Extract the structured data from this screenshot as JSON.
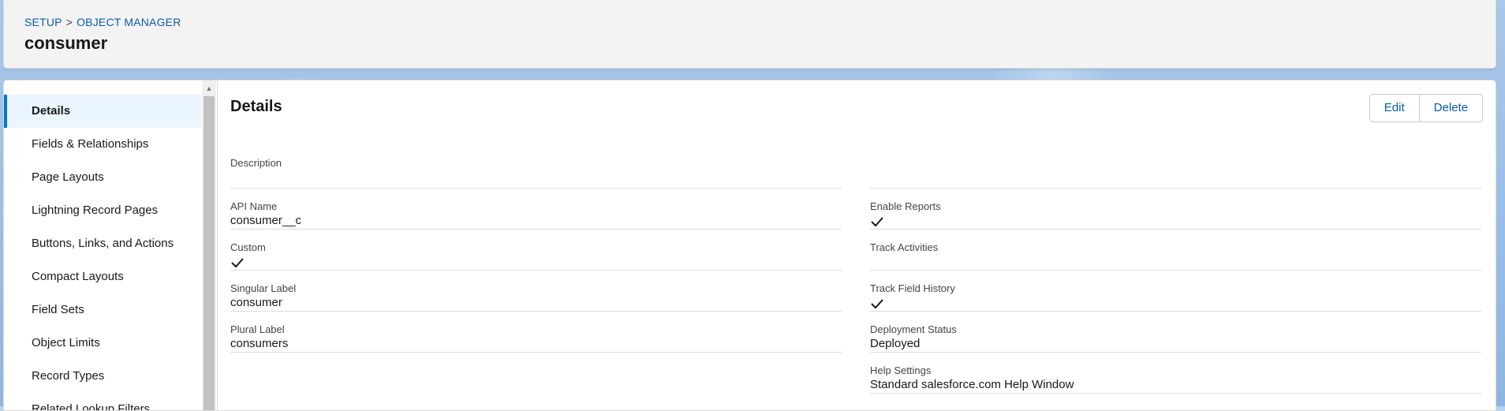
{
  "header": {
    "breadcrumb": [
      "SETUP",
      "OBJECT MANAGER"
    ],
    "breadcrumb_separator": ">",
    "title": "consumer"
  },
  "sidebar": {
    "items": [
      {
        "label": "Details",
        "active": true
      },
      {
        "label": "Fields & Relationships"
      },
      {
        "label": "Page Layouts"
      },
      {
        "label": "Lightning Record Pages"
      },
      {
        "label": "Buttons, Links, and Actions"
      },
      {
        "label": "Compact Layouts"
      },
      {
        "label": "Field Sets"
      },
      {
        "label": "Object Limits"
      },
      {
        "label": "Record Types"
      },
      {
        "label": "Related Lookup Filters"
      }
    ]
  },
  "details": {
    "title": "Details",
    "edit_label": "Edit",
    "delete_label": "Delete",
    "fields": {
      "description": {
        "label": "Description",
        "value": ""
      },
      "api_name": {
        "label": "API Name",
        "value": "consumer__c"
      },
      "custom": {
        "label": "Custom",
        "checked": true
      },
      "singular_label": {
        "label": "Singular Label",
        "value": "consumer"
      },
      "plural_label": {
        "label": "Plural Label",
        "value": "consumers"
      },
      "enable_reports": {
        "label": "Enable Reports",
        "checked": true
      },
      "track_activities": {
        "label": "Track Activities",
        "checked": false
      },
      "track_field_history": {
        "label": "Track Field History",
        "checked": true
      },
      "deployment_status": {
        "label": "Deployment Status",
        "value": "Deployed"
      },
      "help_settings": {
        "label": "Help Settings",
        "value": "Standard salesforce.com Help Window"
      }
    }
  },
  "colors": {
    "link": "#0b5cab",
    "active_nav_bg": "#eaf5fe",
    "active_nav_border": "#0176d3"
  }
}
